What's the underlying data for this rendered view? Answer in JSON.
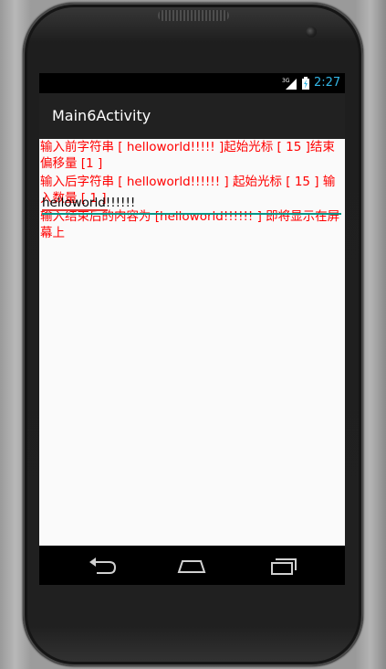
{
  "status_bar": {
    "network": "3G",
    "time": "2:27"
  },
  "action_bar": {
    "title": "Main6Activity"
  },
  "log_lines": [
    "输入前字符串 [ helloworld!!!!! ]起始光标 [ 15 ]结束偏移量  [1 ]",
    "输入后字符串 [ helloworld!!!!!! ] 起始光标 [ 15 ] 输入数量 [ 1 ]",
    "输入结束后的内容为 [helloworld!!!!!! ] 即将显示在屏幕上"
  ],
  "edit_text": {
    "value": "helloworld!!!!!!"
  },
  "colors": {
    "log_text": "#ff0000",
    "accent": "#009688",
    "status_text": "#33b5e5"
  },
  "icons": [
    "signal-icon",
    "battery-icon",
    "back-icon",
    "home-icon",
    "recent-apps-icon"
  ]
}
